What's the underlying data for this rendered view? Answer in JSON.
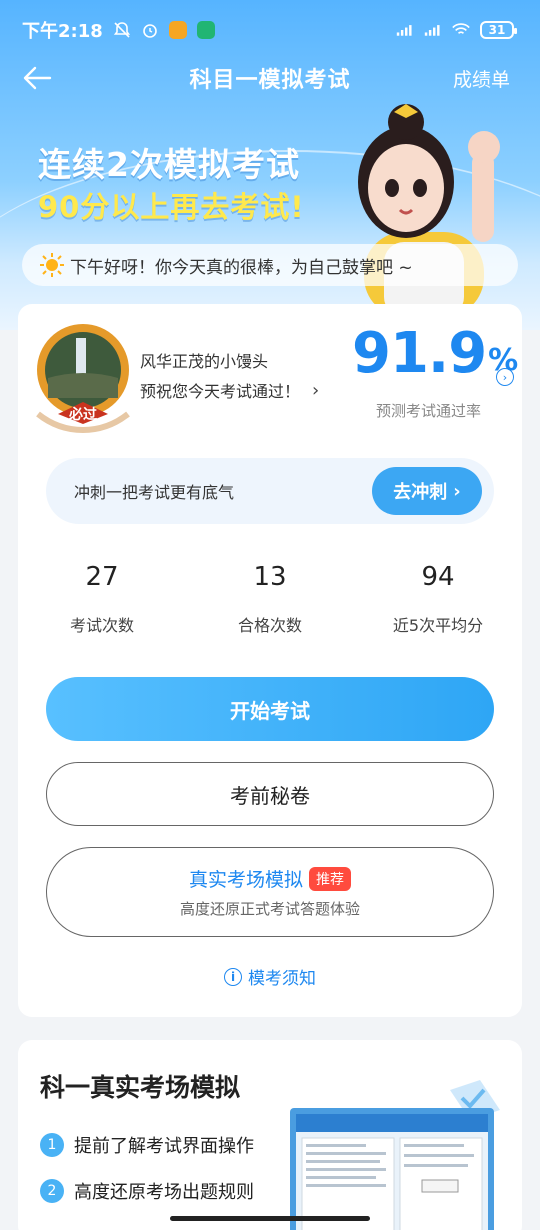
{
  "status_bar": {
    "time": "下午2:18",
    "battery": "31"
  },
  "nav": {
    "title": "科目一模拟考试",
    "right": "成绩单"
  },
  "hero": {
    "line1": "连续2次模拟考试",
    "line2": "90分以上再去考试!",
    "greeting": "下午好呀！你今天真的很棒，为自己鼓掌吧 ~"
  },
  "profile": {
    "badge_text": "必过",
    "name": "风华正茂的小馒头",
    "wish": "预祝您今天考试通过！",
    "pass_rate": "91.9",
    "pass_rate_unit": "%",
    "pass_rate_label": "预测考试通过率"
  },
  "sprint": {
    "text": "冲刺一把考试更有底气",
    "button": "去冲刺"
  },
  "stats": [
    {
      "value": "27",
      "label": "考试次数"
    },
    {
      "value": "13",
      "label": "合格次数"
    },
    {
      "value": "94",
      "label": "近5次平均分"
    }
  ],
  "buttons": {
    "start": "开始考试",
    "secret": "考前秘卷",
    "real_title": "真实考场模拟",
    "real_tag": "推荐",
    "real_sub": "高度还原正式考试答题体验",
    "notice": "模考须知"
  },
  "section2": {
    "title": "科一真实考场模拟",
    "features": [
      {
        "num": "1",
        "text": "提前了解考试界面操作"
      },
      {
        "num": "2",
        "text": "高度还原考场出题规则"
      }
    ]
  },
  "colors": {
    "primary": "#1e88f0",
    "accent_yellow": "#ffe94d",
    "tag_red": "#ff4b3e"
  }
}
